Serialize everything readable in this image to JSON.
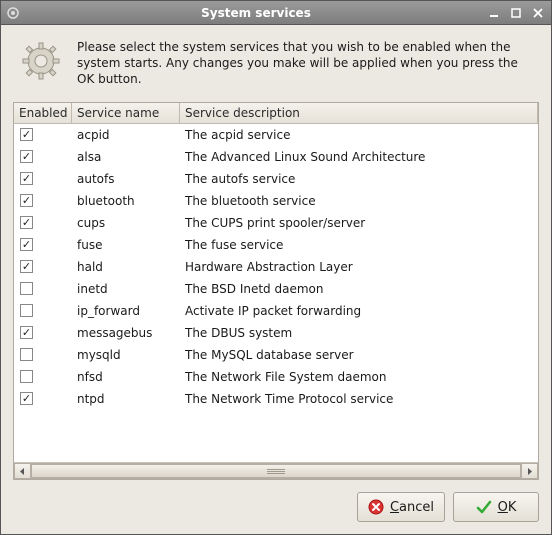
{
  "window": {
    "title": "System services"
  },
  "intro": {
    "text": "Please select the system services that you wish to be enabled when the system starts. Any changes you make will be applied when you press the OK button."
  },
  "table": {
    "headers": {
      "enabled": "Enabled",
      "name": "Service name",
      "desc": "Service description"
    },
    "rows": [
      {
        "enabled": true,
        "name": "acpid",
        "desc": "The acpid service"
      },
      {
        "enabled": true,
        "name": "alsa",
        "desc": "The Advanced Linux Sound Architecture"
      },
      {
        "enabled": true,
        "name": "autofs",
        "desc": "The autofs service"
      },
      {
        "enabled": true,
        "name": "bluetooth",
        "desc": "The bluetooth service"
      },
      {
        "enabled": true,
        "name": "cups",
        "desc": "The CUPS print spooler/server"
      },
      {
        "enabled": true,
        "name": "fuse",
        "desc": "The fuse service"
      },
      {
        "enabled": true,
        "name": "hald",
        "desc": "Hardware Abstraction Layer"
      },
      {
        "enabled": false,
        "name": "inetd",
        "desc": "The BSD Inetd daemon"
      },
      {
        "enabled": false,
        "name": "ip_forward",
        "desc": "Activate IP packet forwarding"
      },
      {
        "enabled": true,
        "name": "messagebus",
        "desc": "The DBUS system"
      },
      {
        "enabled": false,
        "name": "mysqld",
        "desc": "The MySQL database server"
      },
      {
        "enabled": false,
        "name": "nfsd",
        "desc": "The Network File System daemon"
      },
      {
        "enabled": true,
        "name": "ntpd",
        "desc": "The Network Time Protocol service"
      }
    ]
  },
  "footer": {
    "cancel": "Cancel",
    "ok": "OK"
  }
}
